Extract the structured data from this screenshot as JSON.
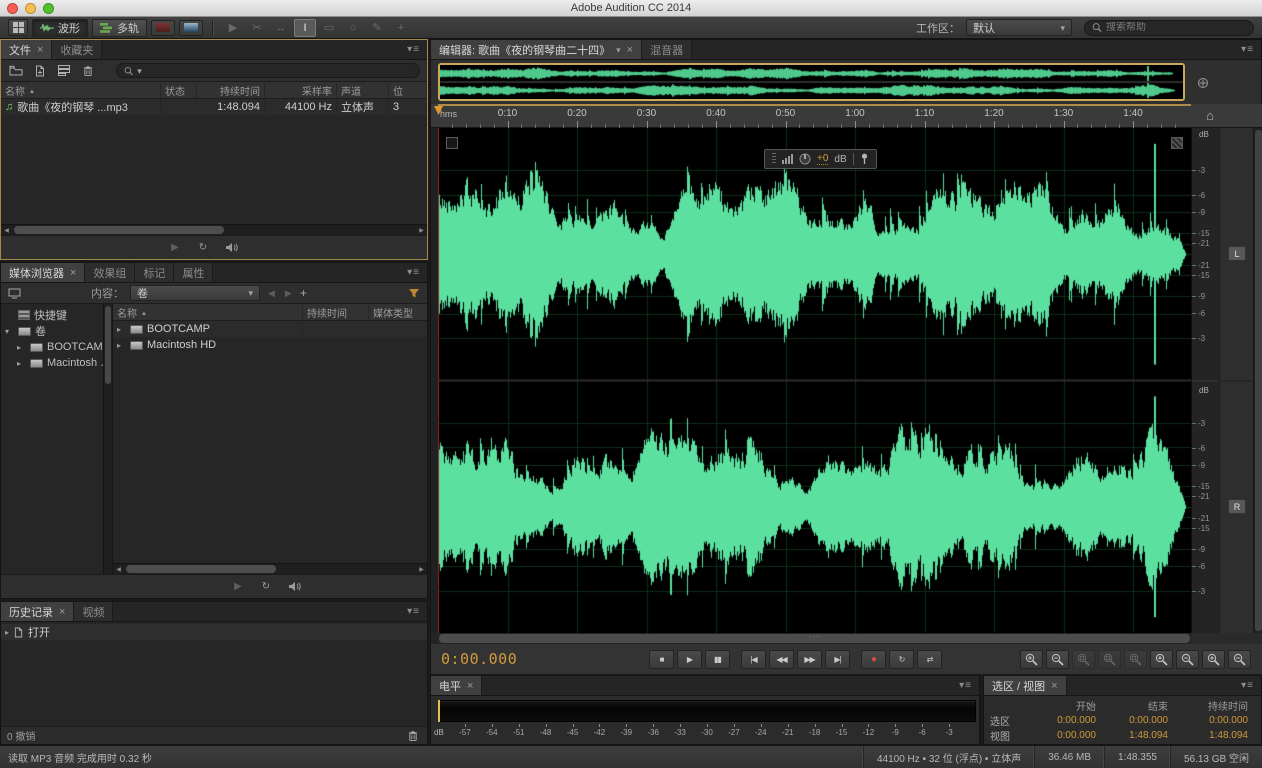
{
  "window": {
    "title": "Adobe Audition CC 2014"
  },
  "toolbar": {
    "waveform_label": "波形",
    "multitrack_label": "多轨",
    "workspace_label": "工作区：",
    "workspace_value": "默认",
    "search_placeholder": "搜索帮助",
    "tools": [
      {
        "name": "move-tool",
        "enabled": false
      },
      {
        "name": "razor-tool",
        "enabled": false
      },
      {
        "name": "slip-tool",
        "enabled": false
      },
      {
        "name": "time-selection-tool",
        "enabled": true,
        "active": true
      },
      {
        "name": "marquee-selection-tool",
        "enabled": false
      },
      {
        "name": "lasso-selection-tool",
        "enabled": false
      },
      {
        "name": "paintbrush-selection-tool",
        "enabled": false
      },
      {
        "name": "spot-healing-brush-tool",
        "enabled": false
      }
    ]
  },
  "files_panel": {
    "tabs": [
      "文件",
      "收藏夹"
    ],
    "toolbar_icons": [
      "open-file",
      "import-file",
      "insert-into-multitrack",
      "delete"
    ],
    "search_value": "",
    "columns": [
      "名称",
      "状态",
      "持续时间",
      "采样率",
      "声道",
      "位"
    ],
    "rows": [
      {
        "name": "歌曲《夜的钢琴 ...mp3",
        "status": "",
        "duration": "1:48.094",
        "sample_rate": "44100 Hz",
        "channels": "立体声",
        "bits": "3"
      }
    ],
    "preview_icons": [
      "play-preview",
      "loop-preview",
      "auto-play"
    ]
  },
  "media_panel": {
    "tabs": [
      "媒体浏览器",
      "效果组",
      "标记",
      "属性"
    ],
    "content_label": "内容：",
    "content_value": "卷",
    "tree": [
      {
        "label": "快捷键",
        "icon": "shortcuts-icon",
        "twisty": "",
        "indent": 0
      },
      {
        "label": "卷",
        "icon": "drive-icon",
        "twisty": "open",
        "indent": 0
      },
      {
        "label": "BOOTCAMP",
        "icon": "drive-icon",
        "twisty": "closed",
        "indent": 1
      },
      {
        "label": "Macintosh HD",
        "icon": "drive-icon",
        "twisty": "closed",
        "indent": 1
      }
    ],
    "columns": [
      "名称",
      "持续时间",
      "媒体类型"
    ],
    "rows": [
      {
        "name": "BOOTCAMP"
      },
      {
        "name": "Macintosh HD"
      }
    ],
    "preview_icons": [
      "play-preview",
      "loop-preview",
      "auto-play"
    ]
  },
  "history_panel": {
    "tabs": [
      "历史记录",
      "视频"
    ],
    "items": [
      {
        "label": "打开"
      }
    ],
    "undo_status": "0 撤销"
  },
  "editor": {
    "tab_label": "编辑器: 歌曲《夜的钢琴曲二十四》",
    "mixer_tab_label": "混音器",
    "time_unit": "hms",
    "timeline_ticks": [
      "0:10",
      "0:20",
      "0:30",
      "0:40",
      "0:50",
      "1:00",
      "1:10",
      "1:20",
      "1:30",
      "1:40"
    ],
    "hud": {
      "gain_value": "+0",
      "unit": "dB"
    },
    "db_unit": "dB",
    "db_labels": [
      "-3",
      "-6",
      "-9",
      "-15",
      "-21"
    ],
    "channel_labels": [
      "L",
      "R"
    ],
    "time_display": "0:00.000",
    "transport": [
      {
        "name": "stop-button"
      },
      {
        "name": "play-button"
      },
      {
        "name": "pause-button"
      },
      {
        "name": "skip-to-start-button"
      },
      {
        "name": "rewind-button"
      },
      {
        "name": "fast-forward-button"
      },
      {
        "name": "skip-to-end-button"
      },
      {
        "name": "record-button"
      },
      {
        "name": "loop-playback-button"
      },
      {
        "name": "skip-selection-button"
      }
    ],
    "zoom_buttons": [
      {
        "name": "zoom-in-full",
        "sign": "+",
        "enabled": true
      },
      {
        "name": "zoom-out-full",
        "sign": "-",
        "enabled": true
      },
      {
        "name": "zoom-to-selection",
        "sign": "sel",
        "enabled": false
      },
      {
        "name": "zoom-selection-in-point",
        "sign": "sel",
        "enabled": false
      },
      {
        "name": "zoom-selection-out-point",
        "sign": "sel",
        "enabled": false
      },
      {
        "name": "zoom-in-horizontal",
        "sign": "+",
        "enabled": true
      },
      {
        "name": "zoom-out-horizontal",
        "sign": "-",
        "enabled": true
      },
      {
        "name": "zoom-in-vertical",
        "sign": "+",
        "enabled": true
      },
      {
        "name": "zoom-out-vertical",
        "sign": "-",
        "enabled": true
      }
    ]
  },
  "levels_panel": {
    "tab": "电平",
    "unit": "dB",
    "scale": [
      "-57",
      "-54",
      "-51",
      "-48",
      "-45",
      "-42",
      "-39",
      "-36",
      "-33",
      "-30",
      "-27",
      "-24",
      "-21",
      "-18",
      "-15",
      "-12",
      "-9",
      "-6",
      "-3"
    ]
  },
  "selection_panel": {
    "tab": "选区 / 视图",
    "columns": [
      "开始",
      "结束",
      "持续时间"
    ],
    "rows": [
      {
        "label": "选区",
        "start": "0:00.000",
        "end": "0:00.000",
        "duration": "0:00.000"
      },
      {
        "label": "视图",
        "start": "0:00.000",
        "end": "1:48.094",
        "duration": "1:48.094"
      }
    ]
  },
  "status_bar": {
    "message": "读取 MP3 音频 完成用时 0.32 秒",
    "format": "44100 Hz • 32 位 (浮点) • 立体声",
    "file_size": "36.46 MB",
    "duration": "1:48.355",
    "free_space": "56.13 GB 空闲"
  },
  "colors": {
    "waveform_green": "#5ce0a0",
    "accent_orange": "#d19a3b",
    "focus_border": "#a5874b"
  }
}
